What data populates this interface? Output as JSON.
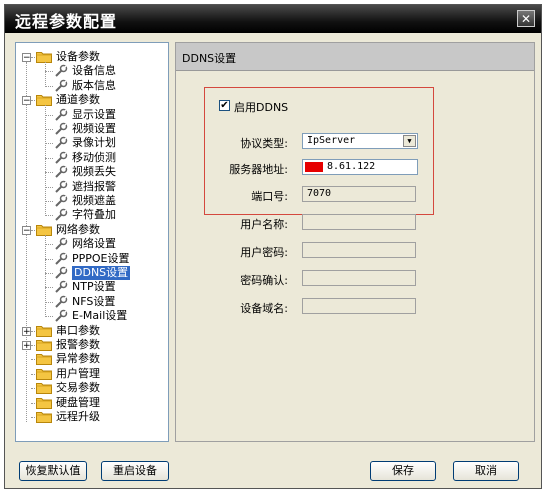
{
  "window": {
    "title": "远程参数配置",
    "close_glyph": "✕"
  },
  "tree": {
    "groups": [
      {
        "label": "设备参数",
        "toggle": "−",
        "children": [
          "设备信息",
          "版本信息"
        ]
      },
      {
        "label": "通道参数",
        "toggle": "−",
        "children": [
          "显示设置",
          "视频设置",
          "录像计划",
          "移动侦测",
          "视频丢失",
          "遮挡报警",
          "视频遮盖",
          "字符叠加"
        ]
      },
      {
        "label": "网络参数",
        "toggle": "−",
        "children": [
          "网络设置",
          "PPPOE设置",
          "DDNS设置",
          "NTP设置",
          "NFS设置",
          "E-Mail设置"
        ]
      },
      {
        "label": "串口参数",
        "toggle": "+",
        "children": []
      },
      {
        "label": "报警参数",
        "toggle": "+",
        "children": []
      },
      {
        "label": "异常参数",
        "toggle": "",
        "children": []
      },
      {
        "label": "用户管理",
        "toggle": "",
        "children": []
      },
      {
        "label": "交易参数",
        "toggle": "",
        "children": []
      },
      {
        "label": "硬盘管理",
        "toggle": "",
        "children": []
      },
      {
        "label": "远程升级",
        "toggle": "",
        "children": []
      }
    ],
    "selected": "DDNS设置"
  },
  "panel": {
    "header": "DDNS设置",
    "enable_label": "启用DDNS",
    "enable_checked": "✔",
    "fields": {
      "protocol_label": "协议类型:",
      "protocol_value": "IpServer",
      "server_label": "服务器地址:",
      "server_value": "8.61.122",
      "port_label": "端口号:",
      "port_value": "7070",
      "username_label": "用户名称:",
      "password_label": "用户密码:",
      "confirm_label": "密码确认:",
      "domain_label": "设备域名:"
    }
  },
  "buttons": {
    "restore": "恢复默认值",
    "restart": "重启设备",
    "save": "保存",
    "cancel": "取消"
  },
  "colors": {
    "selection": "#316ac5",
    "highlight_box": "#d4483e",
    "mask": "#e60000"
  }
}
